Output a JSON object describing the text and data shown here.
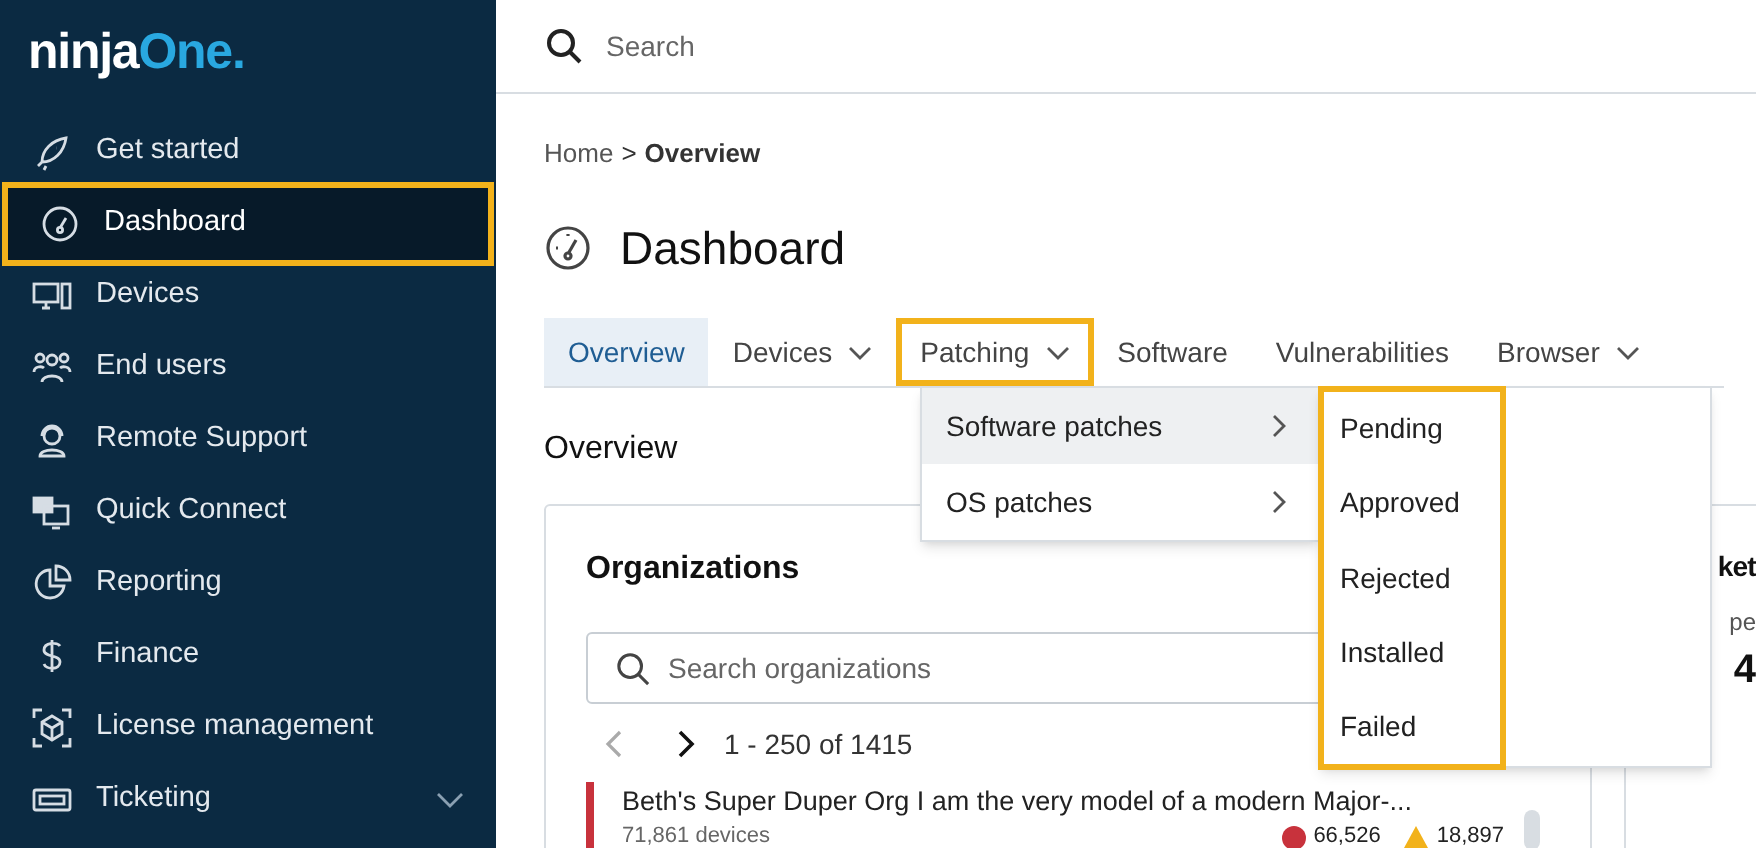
{
  "logo": {
    "part_1": "ninja",
    "part_2": "One",
    "part_3": "."
  },
  "sidebar": {
    "items": [
      {
        "label": "Get started",
        "selected": false,
        "highlighted": false,
        "expandable": false
      },
      {
        "label": "Dashboard",
        "selected": true,
        "highlighted": true,
        "expandable": false
      },
      {
        "label": "Devices",
        "selected": false,
        "highlighted": false,
        "expandable": false
      },
      {
        "label": "End users",
        "selected": false,
        "highlighted": false,
        "expandable": false
      },
      {
        "label": "Remote Support",
        "selected": false,
        "highlighted": false,
        "expandable": false
      },
      {
        "label": "Quick Connect",
        "selected": false,
        "highlighted": false,
        "expandable": false
      },
      {
        "label": "Reporting",
        "selected": false,
        "highlighted": false,
        "expandable": false
      },
      {
        "label": "Finance",
        "selected": false,
        "highlighted": false,
        "expandable": false
      },
      {
        "label": "License management",
        "selected": false,
        "highlighted": false,
        "expandable": false
      },
      {
        "label": "Ticketing",
        "selected": false,
        "highlighted": false,
        "expandable": true
      }
    ]
  },
  "search": {
    "placeholder": "Search"
  },
  "breadcrumb": {
    "parent": "Home",
    "separator": ">",
    "current": "Overview"
  },
  "page_title": "Dashboard",
  "tabs": [
    {
      "label": "Overview",
      "selected": true,
      "dropdown": false,
      "highlighted": false
    },
    {
      "label": "Devices",
      "selected": false,
      "dropdown": true,
      "highlighted": false
    },
    {
      "label": "Patching",
      "selected": false,
      "dropdown": true,
      "highlighted": true
    },
    {
      "label": "Software",
      "selected": false,
      "dropdown": false,
      "highlighted": false
    },
    {
      "label": "Vulnerabilities",
      "selected": false,
      "dropdown": false,
      "highlighted": false
    },
    {
      "label": "Browser",
      "selected": false,
      "dropdown": true,
      "highlighted": false
    }
  ],
  "section_title": "Overview",
  "menu": {
    "items": [
      {
        "label": "Software patches",
        "selected": true
      },
      {
        "label": "OS patches",
        "selected": false
      }
    ],
    "submenu": {
      "highlighted": true,
      "items": [
        "Pending",
        "Approved",
        "Rejected",
        "Installed",
        "Failed"
      ]
    }
  },
  "organizations": {
    "title": "Organizations",
    "search_placeholder": "Search organizations",
    "range": "1 - 250 of 1415",
    "rows": [
      {
        "name": "Beth's Super Duper Org I am the very model of a modern Major-...",
        "color": "#c8323c",
        "devices": "71,861 devices",
        "critical": "66,526",
        "warnings": "18,897"
      }
    ]
  },
  "side_card": {
    "title": "ket",
    "label": "pe",
    "value": "4"
  }
}
